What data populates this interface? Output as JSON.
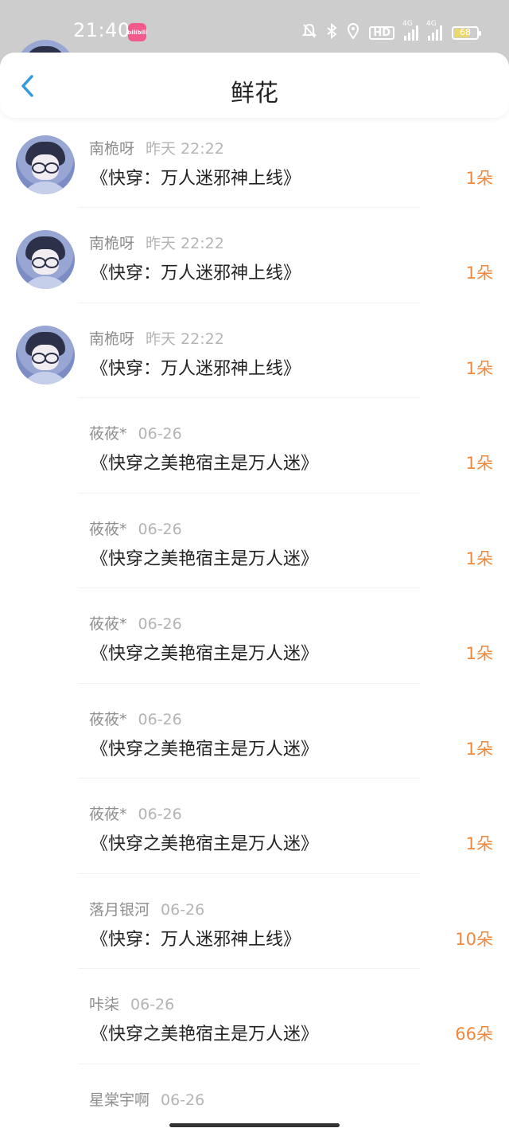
{
  "status_bar": {
    "time": "21:40",
    "app_badge_text": "bilibili",
    "hd_label": "HD",
    "signal1_label": "4G",
    "signal2_label": "4G",
    "battery_level": "68",
    "battery_fraction": 0.68,
    "icons": [
      "mute-bell-icon",
      "bluetooth-icon",
      "location-icon",
      "hd-icon",
      "signal-4g-icon",
      "signal-4g-icon",
      "battery-icon"
    ]
  },
  "header": {
    "title": "鲜花",
    "back_icon": "chevron-left-icon"
  },
  "colors": {
    "accent_blue": "#2f9bdc",
    "count_orange": "#f0883c",
    "statusbar_bg": "#cdcdcd"
  },
  "rows": [
    {
      "name": "",
      "time": "",
      "book": "《快穿：万人迷邪神上线》",
      "count": "1朵",
      "avatar": true
    },
    {
      "name": "南桅呀",
      "time": "昨天 22:22",
      "book": "《快穿：万人迷邪神上线》",
      "count": "1朵",
      "avatar": true
    },
    {
      "name": "南桅呀",
      "time": "昨天 22:22",
      "book": "《快穿：万人迷邪神上线》",
      "count": "1朵",
      "avatar": true
    },
    {
      "name": "南桅呀",
      "time": "昨天 22:22",
      "book": "《快穿：万人迷邪神上线》",
      "count": "1朵",
      "avatar": true
    },
    {
      "name": "莜莜*",
      "time": "06-26",
      "book": "《快穿之美艳宿主是万人迷》",
      "count": "1朵",
      "avatar": false
    },
    {
      "name": "莜莜*",
      "time": "06-26",
      "book": "《快穿之美艳宿主是万人迷》",
      "count": "1朵",
      "avatar": false
    },
    {
      "name": "莜莜*",
      "time": "06-26",
      "book": "《快穿之美艳宿主是万人迷》",
      "count": "1朵",
      "avatar": false
    },
    {
      "name": "莜莜*",
      "time": "06-26",
      "book": "《快穿之美艳宿主是万人迷》",
      "count": "1朵",
      "avatar": false
    },
    {
      "name": "莜莜*",
      "time": "06-26",
      "book": "《快穿之美艳宿主是万人迷》",
      "count": "1朵",
      "avatar": false
    },
    {
      "name": "落月银河",
      "time": "06-26",
      "book": "《快穿：万人迷邪神上线》",
      "count": "10朵",
      "avatar": false
    },
    {
      "name": "咔柒",
      "time": "06-26",
      "book": "《快穿之美艳宿主是万人迷》",
      "count": "66朵",
      "avatar": false
    },
    {
      "name": "星棠宇啊",
      "time": "06-26",
      "book": "",
      "count": "",
      "avatar": false
    }
  ]
}
